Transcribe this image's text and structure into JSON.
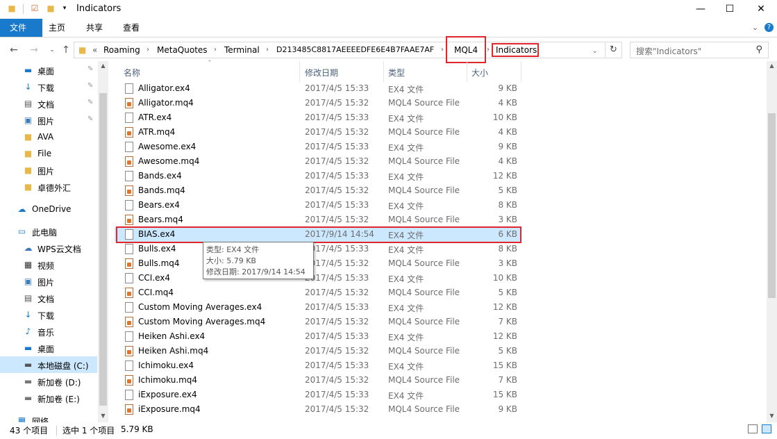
{
  "window": {
    "title": "Indicators"
  },
  "ribbon": {
    "tabs": [
      "文件",
      "主页",
      "共享",
      "查看"
    ]
  },
  "address": {
    "prefix": "«",
    "crumbs": [
      "Roaming",
      "MetaQuotes",
      "Terminal",
      "D213485C8817AEEEEDFE6E4B7FAAE7AF",
      "MQL4",
      "Indicators"
    ]
  },
  "search": {
    "placeholder": "搜索\"Indicators\""
  },
  "nav": {
    "quick": [
      {
        "label": "桌面",
        "icon": "desktop-icon",
        "pinned": true
      },
      {
        "label": "下载",
        "icon": "download-arrow-icon",
        "pinned": true
      },
      {
        "label": "文档",
        "icon": "document-icon",
        "pinned": true
      },
      {
        "label": "图片",
        "icon": "picture-icon",
        "pinned": true
      },
      {
        "label": "AVA",
        "icon": "folder-icon",
        "pinned": false
      },
      {
        "label": "File",
        "icon": "folder-icon",
        "pinned": false
      },
      {
        "label": "图片",
        "icon": "folder-icon",
        "pinned": false
      },
      {
        "label": "卓德外汇",
        "icon": "folder-icon",
        "pinned": false
      }
    ],
    "onedrive": "OneDrive",
    "thispc": "此电脑",
    "pc": [
      {
        "label": "WPS云文档",
        "icon": "cloud-icon"
      },
      {
        "label": "视频",
        "icon": "video-icon"
      },
      {
        "label": "图片",
        "icon": "picture-icon"
      },
      {
        "label": "文档",
        "icon": "document-icon"
      },
      {
        "label": "下载",
        "icon": "download-arrow-icon"
      },
      {
        "label": "音乐",
        "icon": "music-note-icon"
      },
      {
        "label": "桌面",
        "icon": "desktop-icon"
      },
      {
        "label": "本地磁盘 (C:)",
        "icon": "system-drive-icon",
        "selected": true
      },
      {
        "label": "新加卷 (D:)",
        "icon": "drive-icon"
      },
      {
        "label": "新加卷 (E:)",
        "icon": "drive-icon"
      }
    ],
    "network": "网络"
  },
  "columns": {
    "name": "名称",
    "date": "修改日期",
    "type": "类型",
    "size": "大小"
  },
  "files": [
    {
      "name": "Alligator.ex4",
      "date": "2017/4/5 15:33",
      "type": "EX4 文件",
      "size": "9 KB"
    },
    {
      "name": "Alligator.mq4",
      "date": "2017/4/5 15:32",
      "type": "MQL4 Source File",
      "size": "4 KB"
    },
    {
      "name": "ATR.ex4",
      "date": "2017/4/5 15:33",
      "type": "EX4 文件",
      "size": "10 KB"
    },
    {
      "name": "ATR.mq4",
      "date": "2017/4/5 15:32",
      "type": "MQL4 Source File",
      "size": "4 KB"
    },
    {
      "name": "Awesome.ex4",
      "date": "2017/4/5 15:33",
      "type": "EX4 文件",
      "size": "9 KB"
    },
    {
      "name": "Awesome.mq4",
      "date": "2017/4/5 15:32",
      "type": "MQL4 Source File",
      "size": "4 KB"
    },
    {
      "name": "Bands.ex4",
      "date": "2017/4/5 15:33",
      "type": "EX4 文件",
      "size": "12 KB"
    },
    {
      "name": "Bands.mq4",
      "date": "2017/4/5 15:32",
      "type": "MQL4 Source File",
      "size": "5 KB"
    },
    {
      "name": "Bears.ex4",
      "date": "2017/4/5 15:33",
      "type": "EX4 文件",
      "size": "8 KB"
    },
    {
      "name": "Bears.mq4",
      "date": "2017/4/5 15:32",
      "type": "MQL4 Source File",
      "size": "3 KB"
    },
    {
      "name": "BIAS.ex4",
      "date": "2017/9/14 14:54",
      "type": "EX4 文件",
      "size": "6 KB",
      "selected": true
    },
    {
      "name": "Bulls.ex4",
      "date": "2017/4/5 15:33",
      "type": "EX4 文件",
      "size": "8 KB"
    },
    {
      "name": "Bulls.mq4",
      "date": "2017/4/5 15:32",
      "type": "MQL4 Source File",
      "size": "3 KB"
    },
    {
      "name": "CCI.ex4",
      "date": "2017/4/5 15:33",
      "type": "EX4 文件",
      "size": "10 KB"
    },
    {
      "name": "CCI.mq4",
      "date": "2017/4/5 15:32",
      "type": "MQL4 Source File",
      "size": "5 KB"
    },
    {
      "name": "Custom Moving Averages.ex4",
      "date": "2017/4/5 15:33",
      "type": "EX4 文件",
      "size": "12 KB"
    },
    {
      "name": "Custom Moving Averages.mq4",
      "date": "2017/4/5 15:32",
      "type": "MQL4 Source File",
      "size": "7 KB"
    },
    {
      "name": "Heiken Ashi.ex4",
      "date": "2017/4/5 15:33",
      "type": "EX4 文件",
      "size": "12 KB"
    },
    {
      "name": "Heiken Ashi.mq4",
      "date": "2017/4/5 15:32",
      "type": "MQL4 Source File",
      "size": "5 KB"
    },
    {
      "name": "Ichimoku.ex4",
      "date": "2017/4/5 15:33",
      "type": "EX4 文件",
      "size": "15 KB"
    },
    {
      "name": "Ichimoku.mq4",
      "date": "2017/4/5 15:32",
      "type": "MQL4 Source File",
      "size": "7 KB"
    },
    {
      "name": "iExposure.ex4",
      "date": "2017/4/5 15:33",
      "type": "EX4 文件",
      "size": "15 KB"
    },
    {
      "name": "iExposure.mq4",
      "date": "2017/4/5 15:32",
      "type": "MQL4 Source File",
      "size": "9 KB"
    }
  ],
  "tooltip": {
    "type": "类型: EX4 文件",
    "size": "大小: 5.79 KB",
    "modified": "修改日期: 2017/9/14 14:54"
  },
  "status": {
    "count": "43 个项目",
    "selection": "选中 1 个项目",
    "selsize": "5.79 KB"
  }
}
